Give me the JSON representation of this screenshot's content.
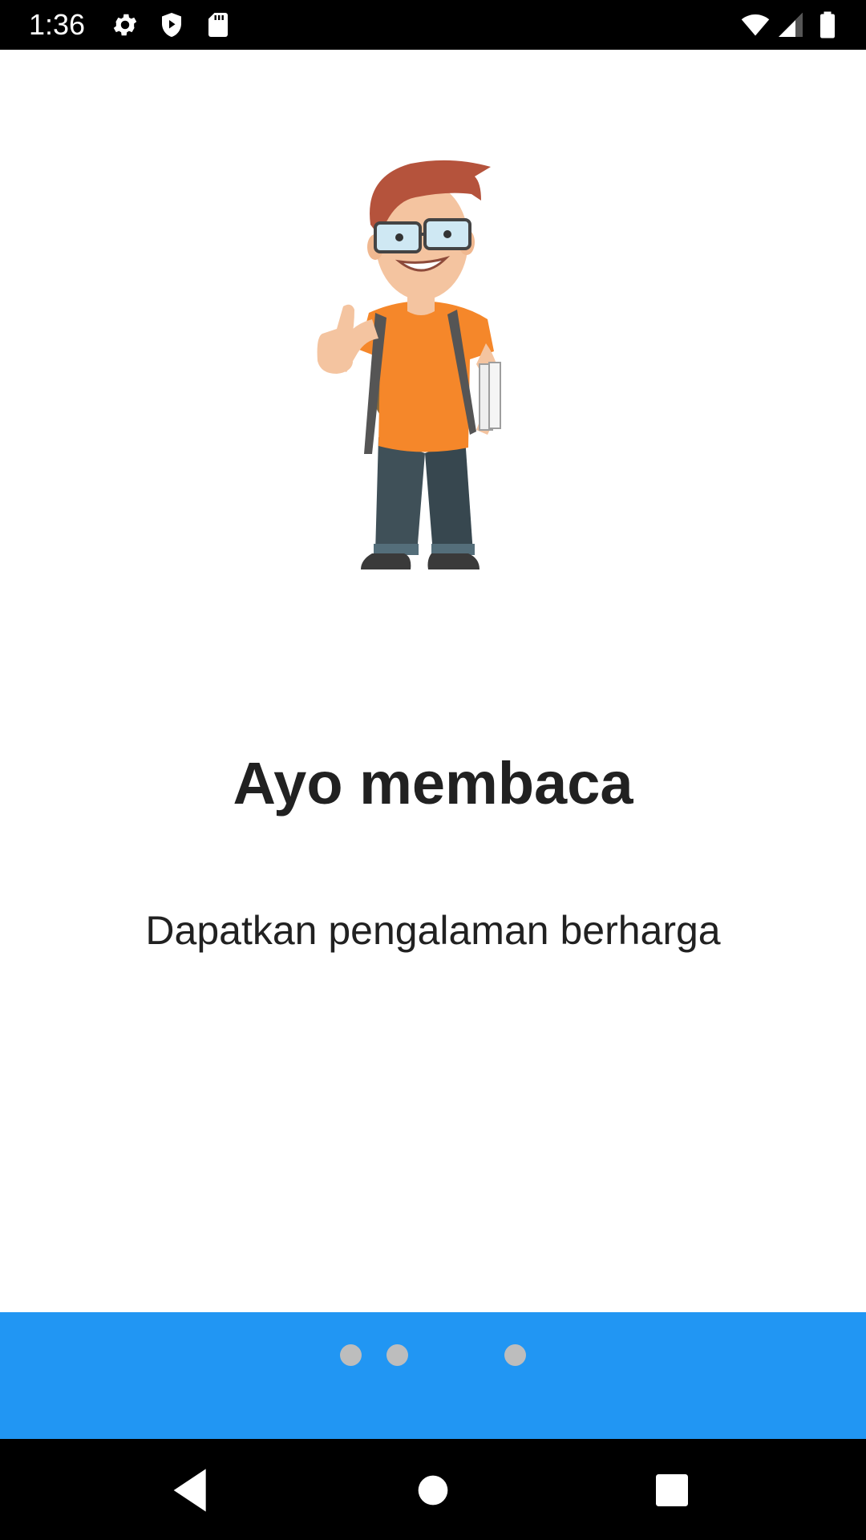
{
  "status_bar": {
    "time": "1:36",
    "left_icons": [
      "gear-icon",
      "shield-play-icon",
      "sd-card-icon"
    ],
    "right_icons": [
      "wifi-icon",
      "cell-signal-icon",
      "battery-icon"
    ]
  },
  "onboarding": {
    "illustration": "student-with-books-thumbs-up",
    "title": "Ayo membaca",
    "subtitle": "Dapatkan pengalaman berharga"
  },
  "indicator": {
    "color": "#2196F3",
    "dot_count": 3,
    "dot_color": "#BDBDBD"
  },
  "nav_bar": {
    "buttons": [
      "back-icon",
      "home-icon",
      "recents-icon"
    ]
  }
}
